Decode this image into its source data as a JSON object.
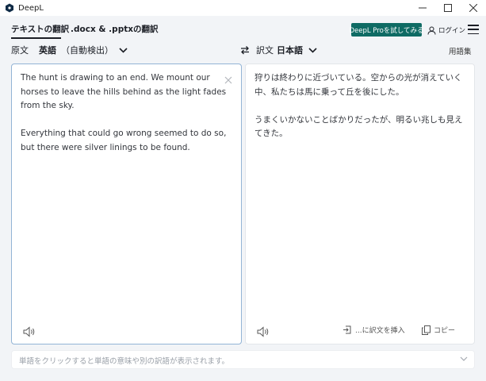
{
  "window": {
    "title": "DeepL",
    "controls": [
      "minimize-icon",
      "maximize-icon",
      "close-icon"
    ]
  },
  "header": {
    "tabs": [
      {
        "label": "テキストの翻訳",
        "active": true
      },
      {
        "label": ".docx & .pptxの翻訳",
        "active": false
      }
    ],
    "pro_button": "DeepL Proを試してみる",
    "login": "ログイン",
    "menu_icon": "hamburger-icon"
  },
  "language_bar": {
    "source_label": "原文",
    "source_language": "英語",
    "source_detect": "（自動検出）",
    "swap_icon": "swap-arrows-icon",
    "target_label": "訳文",
    "target_language": "日本語",
    "glossary": "用語集"
  },
  "source_panel": {
    "paragraphs": [
      "The hunt is drawing to an end. We mount our horses to leave the hills behind as the light fades from the sky.",
      "Everything that could go wrong seemed to do so, but there were silver linings to be found."
    ],
    "clear_icon": "close-icon",
    "speaker_icon": "speaker-icon"
  },
  "target_panel": {
    "paragraphs": [
      "狩りは終わりに近づいている。空からの光が消えていく中、私たちは馬に乗って丘を後にした。",
      "うまくいかないことばかりだったが、明るい兆しも見えてきた。"
    ],
    "speaker_icon": "speaker-icon",
    "insert_label": "...に訳文を挿入",
    "copy_label": "コピー"
  },
  "dictionary_bar": {
    "placeholder": "単語をクリックすると単語の意味や別の訳語が表示されます。"
  },
  "colors": {
    "accent": "#0f6b64",
    "background": "#f2f4f7",
    "focus_border": "#93b4d6"
  }
}
